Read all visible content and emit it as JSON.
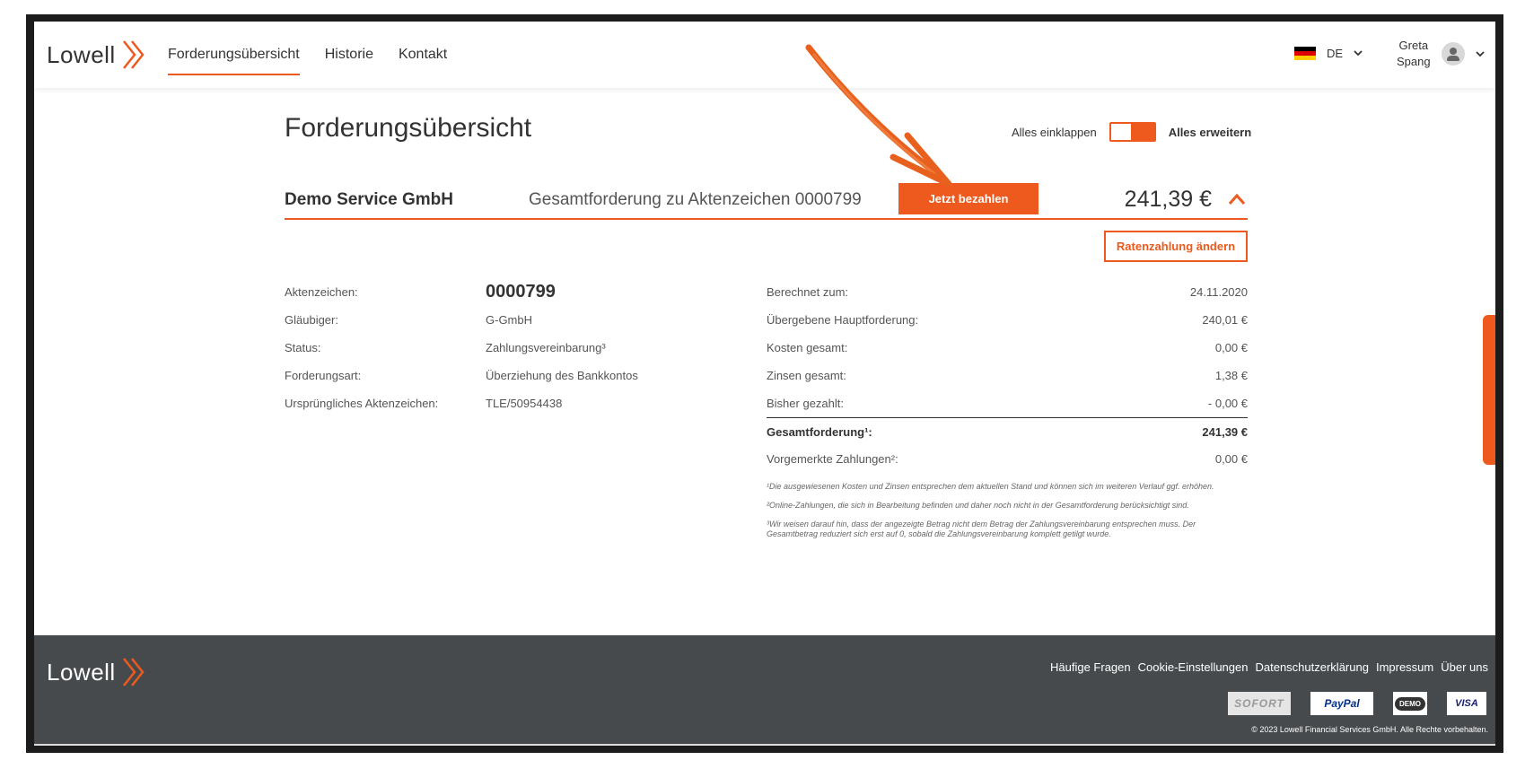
{
  "header": {
    "logo": "Lowell",
    "nav": [
      {
        "label": "Forderungsübersicht",
        "active": true
      },
      {
        "label": "Historie",
        "active": false
      },
      {
        "label": "Kontakt",
        "active": false
      }
    ],
    "language": "DE",
    "user_first": "Greta",
    "user_last": "Spang"
  },
  "page": {
    "title": "Forderungsübersicht",
    "toggle_left": "Alles einklappen",
    "toggle_right": "Alles erweitern"
  },
  "claim": {
    "creditor_name": "Demo Service GmbH",
    "label": "Gesamtforderung zu Aktenzeichen 0000799",
    "pay_button": "Jetzt bezahlen",
    "amount": "241,39 €",
    "installment_button": "Ratenzahlung ändern"
  },
  "details_left": [
    {
      "label": "Aktenzeichen:",
      "value": "0000799"
    },
    {
      "label": "Gläubiger:",
      "value": "G-GmbH"
    },
    {
      "label": "Status:",
      "value": "Zahlungsvereinbarung³"
    },
    {
      "label": "Forderungsart:",
      "value": "Überziehung des Bankkontos"
    },
    {
      "label": "Ursprüngliches Aktenzeichen:",
      "value": "TLE/50954438"
    }
  ],
  "details_right": [
    {
      "label": "Berechnet zum:",
      "value": "24.11.2020"
    },
    {
      "label": "Übergebene Hauptforderung:",
      "value": "240,01 €"
    },
    {
      "label": "Kosten gesamt:",
      "value": "0,00 €"
    },
    {
      "label": "Zinsen gesamt:",
      "value": "1,38 €"
    },
    {
      "label": "Bisher gezahlt:",
      "value": "- 0,00 €"
    },
    {
      "label": "Gesamtforderung¹:",
      "value": "241,39 €"
    },
    {
      "label": "Vorgemerkte Zahlungen²:",
      "value": "0,00 €"
    }
  ],
  "footnotes": [
    "¹Die ausgewiesenen Kosten und Zinsen entsprechen dem aktuellen Stand und können sich im weiteren Verlauf ggf. erhöhen.",
    "²Online-Zahlungen, die sich in Bearbeitung befinden und daher noch nicht in der Gesamtforderung berücksichtigt sind.",
    "³Wir weisen darauf hin, dass der angezeigte Betrag nicht dem Betrag der Zahlungsvereinbarung entsprechen muss. Der Gesamtbetrag reduziert sich erst auf 0, sobald die Zahlungsvereinbarung komplett getilgt wurde."
  ],
  "footer": {
    "logo": "Lowell",
    "links": [
      "Häufige Fragen",
      "Cookie-Einstellungen",
      "Datenschutzerklärung",
      "Impressum",
      "Über uns"
    ],
    "payments": {
      "sofort": "SOFORT",
      "paypal": "PayPal",
      "demo": "DEMO",
      "visa": "VISA"
    },
    "copyright": "© 2023 Lowell Financial Services GmbH. Alle Rechte vorbehalten."
  },
  "colors": {
    "accent": "#ee5a1d",
    "footer_bg": "#464a4d"
  }
}
